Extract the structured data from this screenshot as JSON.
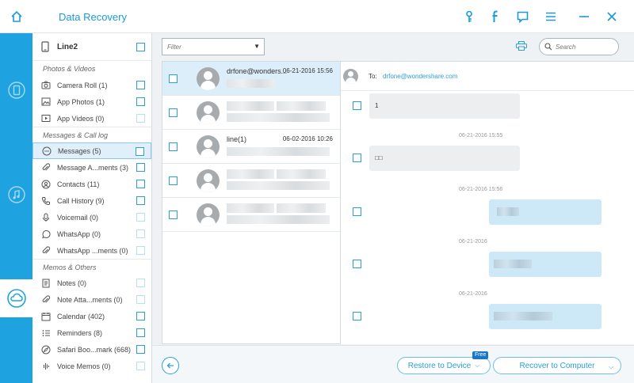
{
  "app": {
    "title": "Data Recovery"
  },
  "categories": {
    "device": "Line2",
    "sections": [
      {
        "title": "Photos & Videos",
        "items": [
          {
            "label": "Camera Roll (1)",
            "icon": "camera-icon"
          },
          {
            "label": "App Photos (1)",
            "icon": "photo-icon"
          },
          {
            "label": "App Videos (0)",
            "icon": "video-icon"
          }
        ]
      },
      {
        "title": "Messages & Call log",
        "items": [
          {
            "label": "Messages (5)",
            "icon": "message-icon"
          },
          {
            "label": "Message A...ments (3)",
            "icon": "attachment-icon"
          },
          {
            "label": "Contacts (11)",
            "icon": "contact-icon"
          },
          {
            "label": "Call History (9)",
            "icon": "phone-icon"
          },
          {
            "label": "Voicemail (0)",
            "icon": "voicemail-icon"
          },
          {
            "label": "WhatsApp (0)",
            "icon": "whatsapp-icon"
          },
          {
            "label": "WhatsApp ...ments (0)",
            "icon": "attachment-icon"
          }
        ]
      },
      {
        "title": "Memos & Others",
        "items": [
          {
            "label": "Notes (0)",
            "icon": "notes-icon"
          },
          {
            "label": "Note Atta...ments (0)",
            "icon": "attachment-icon"
          },
          {
            "label": "Calendar (402)",
            "icon": "calendar-icon"
          },
          {
            "label": "Reminders (8)",
            "icon": "reminder-icon"
          },
          {
            "label": "Safari Boo...mark (668)",
            "icon": "bookmark-icon"
          },
          {
            "label": "Voice Memos (0)",
            "icon": "voice-memo-icon"
          }
        ]
      }
    ]
  },
  "toolbar": {
    "filter_label": "Filter",
    "search_placeholder": "Search"
  },
  "messages": [
    {
      "name": "drfone@wonders...",
      "date": "06-21-2016 15:56"
    },
    {
      "name": "",
      "date": ""
    },
    {
      "name": "line(1)",
      "date": "06-02-2016 10:26"
    },
    {
      "name": "",
      "date": ""
    },
    {
      "name": "",
      "date": ""
    }
  ],
  "conversation": {
    "to_label": "To:",
    "to_address": "drfone@wondershare.com",
    "first_text": "1",
    "second_text": "□□",
    "timestamps": [
      "06-21-2016 15:55",
      "06-21-2016 15:56",
      "06-21-2016",
      "06-21-2016"
    ]
  },
  "actions": {
    "restore_label": "Restore to Device",
    "free_badge": "Free",
    "recover_label": "Recover to Computer"
  },
  "colors": {
    "accent": "#1fa3e0",
    "link": "#2a9fd8"
  }
}
